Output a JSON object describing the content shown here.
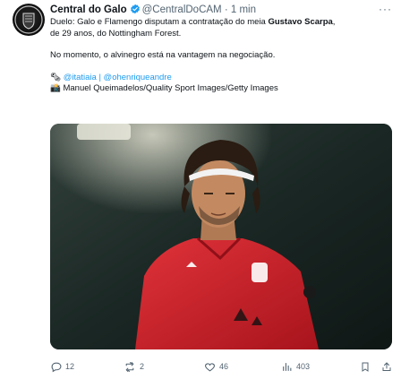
{
  "tweet": {
    "author_name": "Central do Galo",
    "handle": "@CentralDoCAM",
    "separator": "·",
    "time": "1 min",
    "more": "···",
    "line1_pre": "Duelo: Galo e Flamengo disputam a contratação do meia ",
    "line1_bold": "Gustavo Scarpa",
    "line1_post": ",",
    "line2": "de 29 anos, do Nottingham Forest.",
    "line3": "No momento, o alvinegro está na vantagem na negociação.",
    "credit_emoji": "🗞",
    "credit_links": "@itatiaia | @ohenriqueandre",
    "photo_emoji": "📸",
    "photo_credit": "Manuel Queimadelos/Quality Sport Images/Getty Images",
    "media_alt": "Gustavo Scarpa in Nottingham Forest red jersey"
  },
  "actions": {
    "replies": "12",
    "retweets": "2",
    "likes": "46",
    "views": "403"
  },
  "colors": {
    "accent": "#1d9bf0",
    "text": "#0f1419",
    "muted": "#536471",
    "jersey": "#d21f2a"
  }
}
